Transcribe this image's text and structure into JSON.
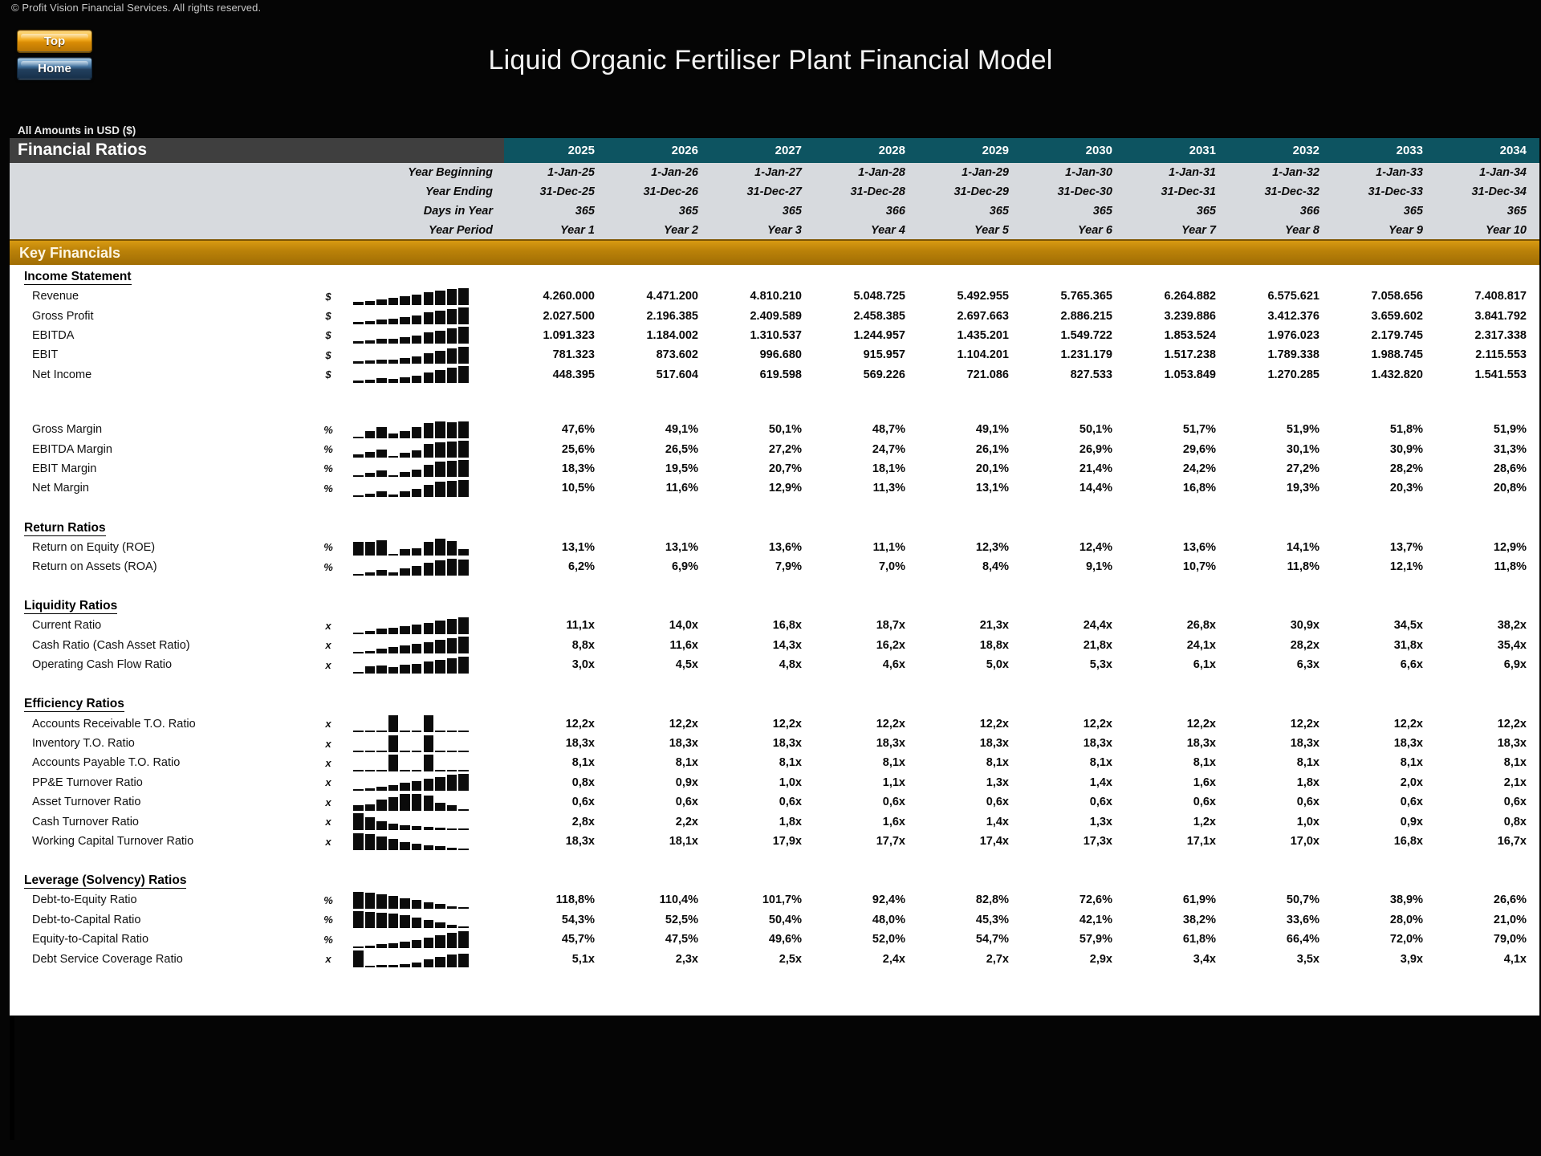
{
  "copyright": "© Profit Vision Financial Services. All rights reserved.",
  "nav": {
    "top_label": "Top",
    "home_label": "Home"
  },
  "title": "Liquid Organic Fertiliser Plant Financial Model",
  "units_note": "All Amounts in  USD ($)",
  "header": {
    "sheet_title": "Financial Ratios",
    "band_title": "Key Financials"
  },
  "colors": {
    "header_band": "#3f3f3f",
    "year_header": "#0d5461",
    "meta_band": "#d7dade",
    "gold_band": "#bb8209",
    "page_background": "#000000",
    "sheet_background": "#ffffff"
  },
  "years": [
    "2025",
    "2026",
    "2027",
    "2028",
    "2029",
    "2030",
    "2031",
    "2032",
    "2033",
    "2034"
  ],
  "meta_rows": [
    {
      "label": "Year Beginning",
      "values": [
        "1-Jan-25",
        "1-Jan-26",
        "1-Jan-27",
        "1-Jan-28",
        "1-Jan-29",
        "1-Jan-30",
        "1-Jan-31",
        "1-Jan-32",
        "1-Jan-33",
        "1-Jan-34"
      ]
    },
    {
      "label": "Year Ending",
      "values": [
        "31-Dec-25",
        "31-Dec-26",
        "31-Dec-27",
        "31-Dec-28",
        "31-Dec-29",
        "31-Dec-30",
        "31-Dec-31",
        "31-Dec-32",
        "31-Dec-33",
        "31-Dec-34"
      ]
    },
    {
      "label": "Days in Year",
      "values": [
        "365",
        "365",
        "365",
        "366",
        "365",
        "365",
        "365",
        "366",
        "365",
        "365"
      ]
    },
    {
      "label": "Year Period",
      "values": [
        "Year 1",
        "Year 2",
        "Year 3",
        "Year 4",
        "Year 5",
        "Year 6",
        "Year 7",
        "Year 8",
        "Year 9",
        "Year 10"
      ]
    }
  ],
  "sections": [
    {
      "heading": "Income Statement",
      "rows": [
        {
          "label": "Revenue",
          "unit": "$",
          "spark": [
            4,
            5,
            7,
            9,
            11,
            13,
            16,
            18,
            20,
            21
          ],
          "values": [
            "4.260.000",
            "4.471.200",
            "4.810.210",
            "5.048.725",
            "5.492.955",
            "5.765.365",
            "6.264.882",
            "6.575.621",
            "7.058.656",
            "7.408.817"
          ]
        },
        {
          "label": "Gross Profit",
          "unit": "$",
          "spark": [
            3,
            4,
            6,
            7,
            9,
            11,
            15,
            17,
            19,
            21
          ],
          "values": [
            "2.027.500",
            "2.196.385",
            "2.409.589",
            "2.458.385",
            "2.697.663",
            "2.886.215",
            "3.239.886",
            "3.412.376",
            "3.659.602",
            "3.841.792"
          ]
        },
        {
          "label": "EBITDA",
          "unit": "$",
          "spark": [
            3,
            4,
            6,
            6,
            8,
            10,
            14,
            16,
            19,
            21
          ],
          "values": [
            "1.091.323",
            "1.184.002",
            "1.310.537",
            "1.244.957",
            "1.435.201",
            "1.549.722",
            "1.853.524",
            "1.976.023",
            "2.179.745",
            "2.317.338"
          ]
        },
        {
          "label": "EBIT",
          "unit": "$",
          "spark": [
            3,
            4,
            5,
            5,
            7,
            9,
            13,
            16,
            19,
            21
          ],
          "values": [
            "781.323",
            "873.602",
            "996.680",
            "915.957",
            "1.104.201",
            "1.231.179",
            "1.517.238",
            "1.789.338",
            "1.988.745",
            "2.115.553"
          ]
        },
        {
          "label": "Net Income",
          "unit": "$",
          "spark": [
            3,
            4,
            6,
            5,
            7,
            9,
            13,
            16,
            19,
            21
          ],
          "values": [
            "448.395",
            "517.604",
            "619.598",
            "569.226",
            "721.086",
            "827.533",
            "1.053.849",
            "1.270.285",
            "1.432.820",
            "1.541.553"
          ]
        }
      ]
    },
    {
      "heading": "",
      "rows": [
        {
          "label": "Gross Margin",
          "unit": "%",
          "spark": [
            2,
            9,
            14,
            6,
            9,
            14,
            19,
            21,
            20,
            21
          ],
          "values": [
            "47,6%",
            "49,1%",
            "50,1%",
            "48,7%",
            "49,1%",
            "50,1%",
            "51,7%",
            "51,9%",
            "51,8%",
            "51,9%"
          ]
        },
        {
          "label": "EBITDA Margin",
          "unit": "%",
          "spark": [
            4,
            7,
            10,
            2,
            6,
            9,
            17,
            19,
            20,
            21
          ],
          "values": [
            "25,6%",
            "26,5%",
            "27,2%",
            "24,7%",
            "26,1%",
            "26,9%",
            "29,6%",
            "30,1%",
            "30,9%",
            "31,3%"
          ]
        },
        {
          "label": "EBIT Margin",
          "unit": "%",
          "spark": [
            2,
            5,
            8,
            2,
            6,
            9,
            15,
            19,
            20,
            21
          ],
          "values": [
            "18,3%",
            "19,5%",
            "20,7%",
            "18,1%",
            "20,1%",
            "21,4%",
            "24,2%",
            "27,2%",
            "28,2%",
            "28,6%"
          ]
        },
        {
          "label": "Net Margin",
          "unit": "%",
          "spark": [
            2,
            4,
            7,
            3,
            7,
            10,
            15,
            19,
            20,
            21
          ],
          "values": [
            "10,5%",
            "11,6%",
            "12,9%",
            "11,3%",
            "13,1%",
            "14,4%",
            "16,8%",
            "19,3%",
            "20,3%",
            "20,8%"
          ]
        }
      ]
    },
    {
      "heading": "Return Ratios",
      "rows": [
        {
          "label": "Return on Equity (ROE)",
          "unit": "%",
          "spark": [
            17,
            17,
            19,
            2,
            8,
            9,
            17,
            21,
            18,
            8
          ],
          "values": [
            "13,1%",
            "13,1%",
            "13,6%",
            "11,1%",
            "12,3%",
            "12,4%",
            "13,6%",
            "14,1%",
            "13,7%",
            "12,9%"
          ]
        },
        {
          "label": "Return on Assets (ROA)",
          "unit": "%",
          "spark": [
            2,
            4,
            7,
            4,
            9,
            12,
            16,
            19,
            21,
            20
          ],
          "values": [
            "6,2%",
            "6,9%",
            "7,9%",
            "7,0%",
            "8,4%",
            "9,1%",
            "10,7%",
            "11,8%",
            "12,1%",
            "11,8%"
          ]
        }
      ]
    },
    {
      "heading": "Liquidity Ratios",
      "rows": [
        {
          "label": "Current Ratio",
          "unit": "x",
          "spark": [
            2,
            4,
            7,
            8,
            10,
            12,
            14,
            17,
            19,
            21
          ],
          "values": [
            "11,1x",
            "14,0x",
            "16,8x",
            "18,7x",
            "21,3x",
            "24,4x",
            "26,8x",
            "30,9x",
            "34,5x",
            "38,2x"
          ]
        },
        {
          "label": "Cash Ratio (Cash Asset Ratio)",
          "unit": "x",
          "spark": [
            2,
            3,
            6,
            8,
            10,
            12,
            14,
            17,
            19,
            21
          ],
          "values": [
            "8,8x",
            "11,6x",
            "14,3x",
            "16,2x",
            "18,8x",
            "21,8x",
            "24,1x",
            "28,2x",
            "31,8x",
            "35,4x"
          ]
        },
        {
          "label": "Operating Cash Flow Ratio",
          "unit": "x",
          "spark": [
            2,
            9,
            10,
            8,
            11,
            12,
            15,
            17,
            19,
            21
          ],
          "values": [
            "3,0x",
            "4,5x",
            "4,8x",
            "4,6x",
            "5,0x",
            "5,3x",
            "6,1x",
            "6,3x",
            "6,6x",
            "6,9x"
          ]
        }
      ]
    },
    {
      "heading": "Efficiency Ratios",
      "rows": [
        {
          "label": "Accounts Receivable T.O. Ratio",
          "unit": "x",
          "spark": [
            1,
            1,
            1,
            21,
            1,
            1,
            21,
            1,
            1,
            1
          ],
          "values": [
            "12,2x",
            "12,2x",
            "12,2x",
            "12,2x",
            "12,2x",
            "12,2x",
            "12,2x",
            "12,2x",
            "12,2x",
            "12,2x"
          ]
        },
        {
          "label": "Inventory T.O. Ratio",
          "unit": "x",
          "spark": [
            1,
            1,
            1,
            21,
            1,
            1,
            21,
            1,
            1,
            1
          ],
          "values": [
            "18,3x",
            "18,3x",
            "18,3x",
            "18,3x",
            "18,3x",
            "18,3x",
            "18,3x",
            "18,3x",
            "18,3x",
            "18,3x"
          ]
        },
        {
          "label": "Accounts Payable T.O. Ratio",
          "unit": "x",
          "spark": [
            1,
            1,
            1,
            21,
            1,
            1,
            21,
            1,
            1,
            1
          ],
          "values": [
            "8,1x",
            "8,1x",
            "8,1x",
            "8,1x",
            "8,1x",
            "8,1x",
            "8,1x",
            "8,1x",
            "8,1x",
            "8,1x"
          ]
        },
        {
          "label": "PP&E Turnover Ratio",
          "unit": "x",
          "spark": [
            2,
            3,
            5,
            7,
            10,
            12,
            15,
            17,
            20,
            21
          ],
          "values": [
            "0,8x",
            "0,9x",
            "1,0x",
            "1,1x",
            "1,3x",
            "1,4x",
            "1,6x",
            "1,8x",
            "2,0x",
            "2,1x"
          ]
        },
        {
          "label": "Asset Turnover Ratio",
          "unit": "x",
          "spark": [
            6,
            7,
            13,
            15,
            19,
            19,
            17,
            9,
            6,
            2
          ],
          "values": [
            "0,6x",
            "0,6x",
            "0,6x",
            "0,6x",
            "0,6x",
            "0,6x",
            "0,6x",
            "0,6x",
            "0,6x",
            "0,6x"
          ]
        },
        {
          "label": "Cash Turnover Ratio",
          "unit": "x",
          "spark": [
            21,
            16,
            11,
            8,
            6,
            5,
            4,
            3,
            2,
            2
          ],
          "values": [
            "2,8x",
            "2,2x",
            "1,8x",
            "1,6x",
            "1,4x",
            "1,3x",
            "1,2x",
            "1,0x",
            "0,9x",
            "0,8x"
          ]
        },
        {
          "label": "Working Capital Turnover Ratio",
          "unit": "x",
          "spark": [
            21,
            20,
            17,
            14,
            10,
            8,
            6,
            5,
            3,
            2
          ],
          "values": [
            "18,3x",
            "18,1x",
            "17,9x",
            "17,7x",
            "17,4x",
            "17,3x",
            "17,1x",
            "17,0x",
            "16,8x",
            "16,7x"
          ]
        }
      ]
    },
    {
      "heading": "Leverage (Solvency) Ratios",
      "rows": [
        {
          "label": "Debt-to-Equity Ratio",
          "unit": "%",
          "spark": [
            21,
            20,
            18,
            16,
            13,
            11,
            8,
            6,
            3,
            2
          ],
          "values": [
            "118,8%",
            "110,4%",
            "101,7%",
            "92,4%",
            "82,8%",
            "72,6%",
            "61,9%",
            "50,7%",
            "38,9%",
            "26,6%"
          ]
        },
        {
          "label": "Debt-to-Capital Ratio",
          "unit": "%",
          "spark": [
            21,
            20,
            19,
            18,
            16,
            13,
            10,
            7,
            4,
            2
          ],
          "values": [
            "54,3%",
            "52,5%",
            "50,4%",
            "48,0%",
            "45,3%",
            "42,1%",
            "38,2%",
            "33,6%",
            "28,0%",
            "21,0%"
          ]
        },
        {
          "label": "Equity-to-Capital Ratio",
          "unit": "%",
          "spark": [
            2,
            3,
            5,
            6,
            8,
            10,
            13,
            16,
            19,
            21
          ],
          "values": [
            "45,7%",
            "47,5%",
            "49,6%",
            "52,0%",
            "54,7%",
            "57,9%",
            "61,8%",
            "66,4%",
            "72,0%",
            "79,0%"
          ]
        },
        {
          "label": "Debt Service Coverage Ratio",
          "unit": "x",
          "spark": [
            21,
            2,
            3,
            3,
            4,
            6,
            10,
            13,
            16,
            17
          ],
          "values": [
            "5,1x",
            "2,3x",
            "2,5x",
            "2,4x",
            "2,7x",
            "2,9x",
            "3,4x",
            "3,5x",
            "3,9x",
            "4,1x"
          ]
        }
      ]
    }
  ]
}
